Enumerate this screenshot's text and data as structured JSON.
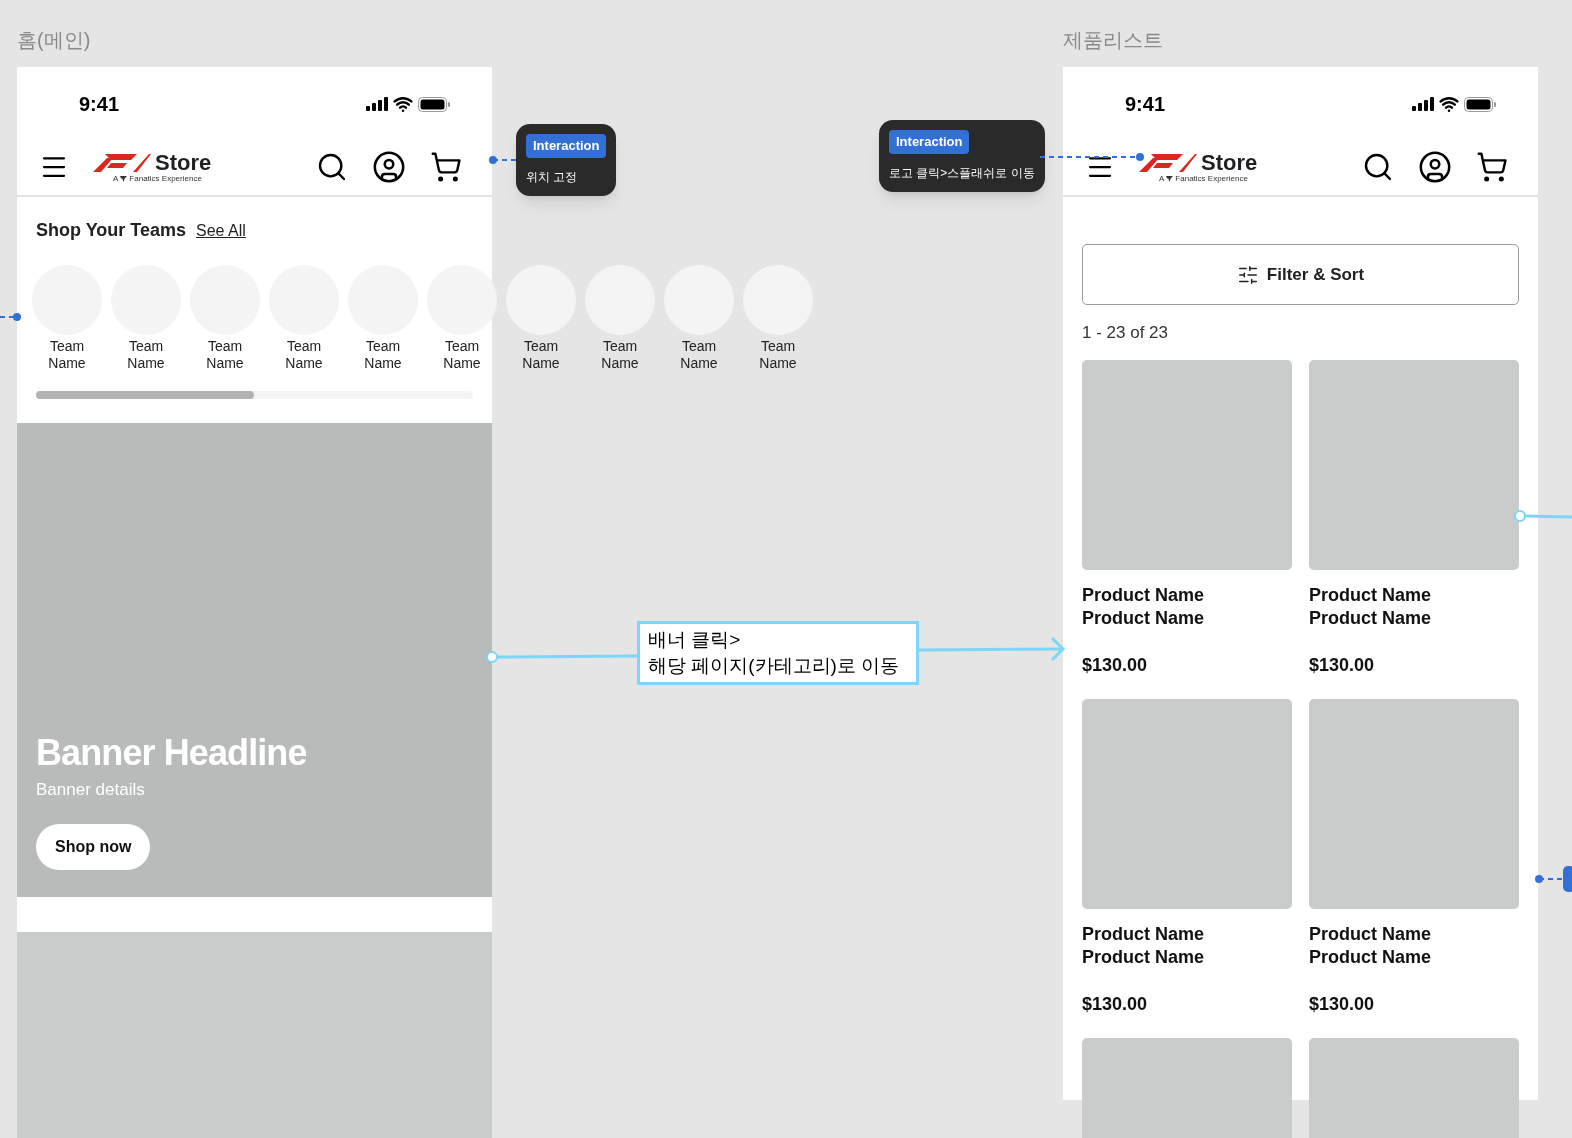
{
  "frames": [
    {
      "kind": "home",
      "label": "홈(메인)",
      "status_time": "9:41",
      "logo": {
        "word": "Store",
        "tagline_a": "A",
        "tagline": "Fanatics Experience"
      },
      "teams_section": {
        "title": "Shop Your Teams",
        "link": "See All",
        "teams": [
          {
            "name": "Team Name"
          },
          {
            "name": "Team Name"
          },
          {
            "name": "Team Name"
          },
          {
            "name": "Team Name"
          },
          {
            "name": "Team Name"
          },
          {
            "name": "Team Name"
          },
          {
            "name": "Team Name"
          },
          {
            "name": "Team Name"
          },
          {
            "name": "Team Name"
          },
          {
            "name": "Team Name"
          }
        ]
      },
      "banner": {
        "headline": "Banner Headline",
        "details": "Banner details",
        "button": "Shop now"
      }
    },
    {
      "kind": "list",
      "label": "제품리스트",
      "status_time": "9:41",
      "logo": {
        "word": "Store",
        "tagline_a": "A",
        "tagline": "Fanatics Experience"
      },
      "filter_button": "Filter & Sort",
      "count": "1 - 23 of 23",
      "products": [
        {
          "kind": "card",
          "name": "Product Name Product Name",
          "price": "$130.00"
        },
        {
          "kind": "card",
          "name": "Product Name Product Name",
          "price": "$130.00"
        },
        {
          "kind": "card",
          "name": "Product Name Product Name",
          "price": "$130.00"
        },
        {
          "kind": "card",
          "name": "Product Name Product Name",
          "price": "$130.00"
        },
        {
          "kind": "image_only"
        },
        {
          "kind": "image_only"
        }
      ]
    }
  ],
  "notes": [
    {
      "badge": "Interaction",
      "text": "위치 고정"
    },
    {
      "badge": "Interaction",
      "text": "로고 클릭>스플래쉬로 이동"
    }
  ],
  "flow_note": {
    "lines": [
      "배너 클릭>",
      "해당 페이지(카테고리)로 이동"
    ]
  }
}
